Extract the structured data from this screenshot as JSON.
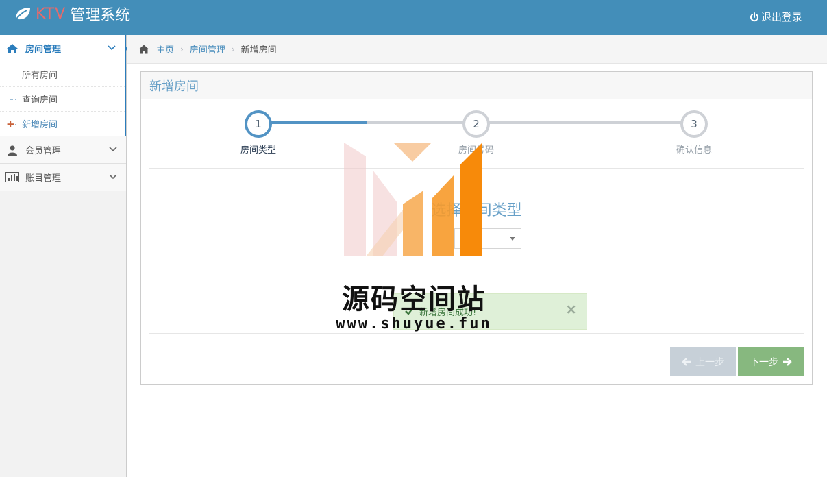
{
  "header": {
    "brand_ktv": "KTV",
    "brand_title": "管理系统",
    "logout_label": "退出登录"
  },
  "sidebar": {
    "items": [
      {
        "label": "房间管理",
        "icon": "home-icon",
        "active": true,
        "children": [
          {
            "label": "所有房间"
          },
          {
            "label": "查询房间"
          },
          {
            "label": "新增房间",
            "current": true
          }
        ]
      },
      {
        "label": "会员管理",
        "icon": "user-icon"
      },
      {
        "label": "账目管理",
        "icon": "bar-chart-icon"
      }
    ]
  },
  "breadcrumb": {
    "home": "主页",
    "section": "房间管理",
    "current": "新增房间"
  },
  "widget": {
    "title": "新增房间",
    "steps": [
      {
        "number": "1",
        "label": "房间类型"
      },
      {
        "number": "2",
        "label": "房间号码"
      },
      {
        "number": "3",
        "label": "确认信息"
      }
    ],
    "pane_title": "选择房间类型",
    "select_value": "",
    "alert_message": "新增房间成功!",
    "alert_close": "×",
    "prev_label": "上一步",
    "next_label": "下一步"
  },
  "watermark": {
    "text": "源码空间站",
    "url": "www.shuyue.fun"
  },
  "colors": {
    "header_bg": "#438eb9",
    "accent": "#2b7dbc",
    "success_bg": "#dff0d8",
    "next_button": "#87b87f",
    "prev_button": "#c7d0d8"
  }
}
